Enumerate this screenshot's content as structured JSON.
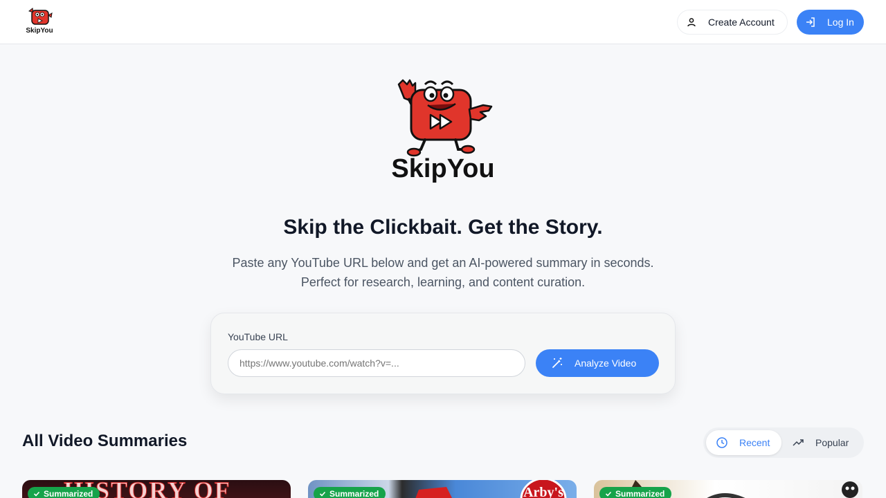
{
  "brand": {
    "name": "SkipYou"
  },
  "header": {
    "create_account_label": "Create Account",
    "login_label": "Log In"
  },
  "hero": {
    "logo_text": "SkipYou",
    "title": "Skip the Clickbait. Get the Story.",
    "subtitle_line1": "Paste any YouTube URL below and get an AI-powered summary in seconds.",
    "subtitle_line2": "Perfect for research, learning, and content curation."
  },
  "form": {
    "label": "YouTube URL",
    "placeholder": "https://www.youtube.com/watch?v=...",
    "analyze_label": "Analyze Video"
  },
  "summaries": {
    "title": "All Video Summaries",
    "tabs": [
      {
        "label": "Recent",
        "icon": "clock-icon",
        "active": true
      },
      {
        "label": "Popular",
        "icon": "trending-up-icon",
        "active": false
      }
    ],
    "videos": [
      {
        "badge": "Summarized",
        "thumb_text": "HISTORY OF"
      },
      {
        "badge": "Summarized",
        "thumb_text": "Arby's"
      },
      {
        "badge": "Summarized"
      }
    ]
  },
  "colors": {
    "accent": "#3b82f6",
    "badge_green": "#16a34a",
    "background": "#f7f8fa",
    "logo_red": "#e0352b"
  }
}
